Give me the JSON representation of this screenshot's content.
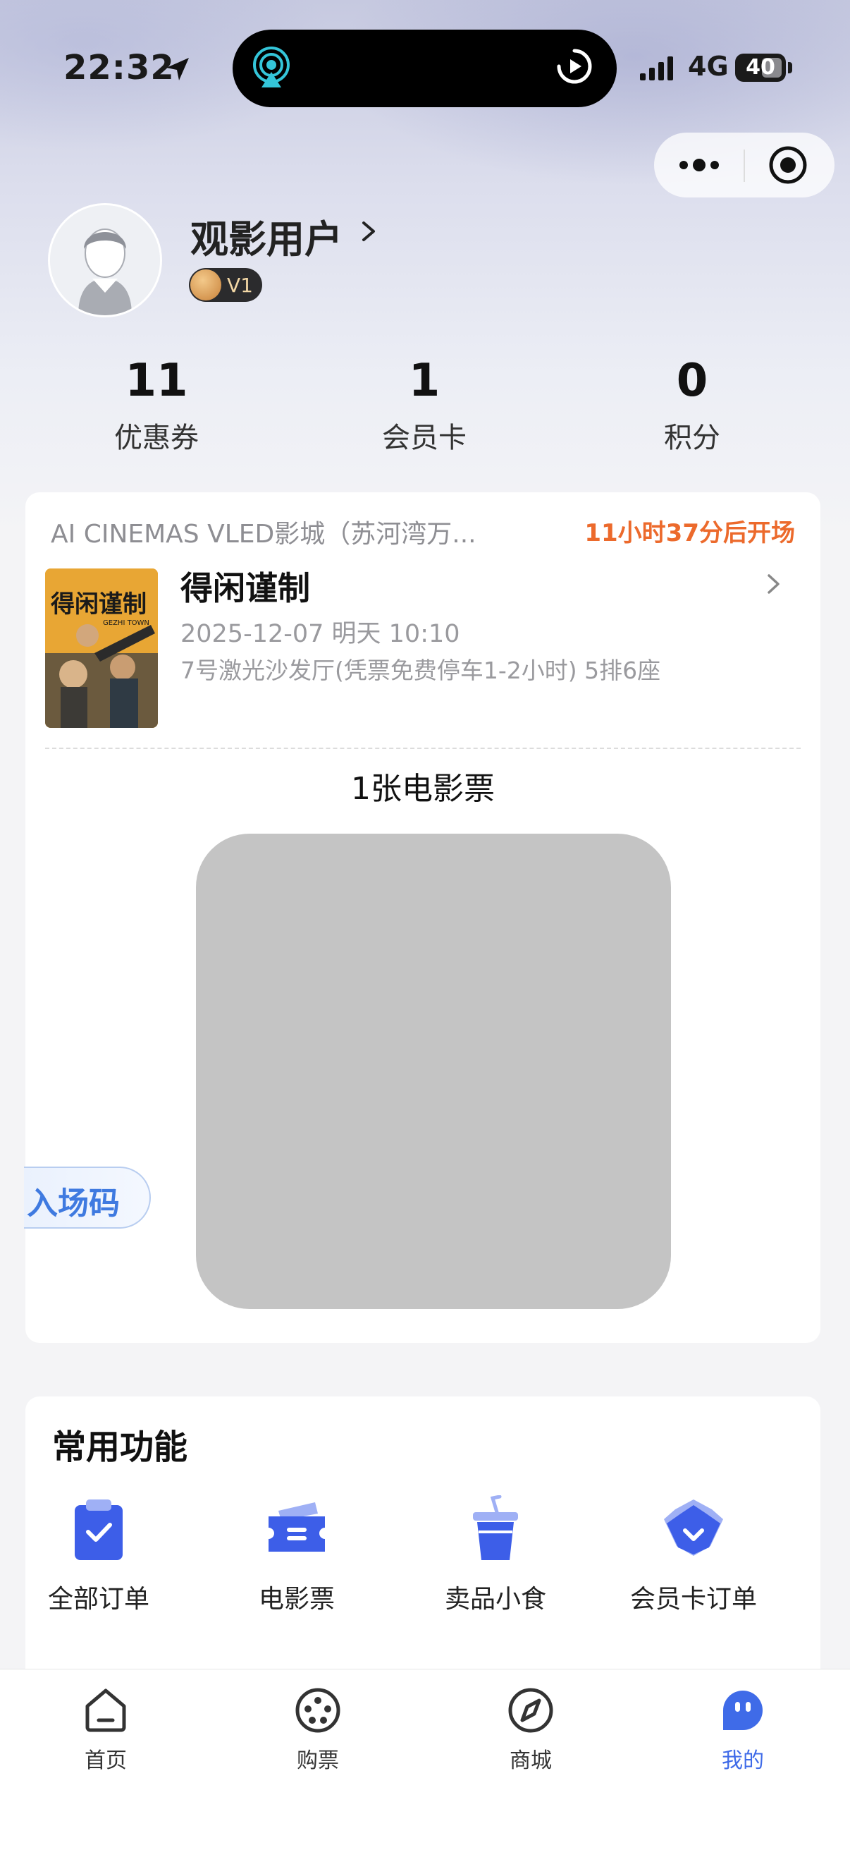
{
  "status_bar": {
    "time": "22:32",
    "network": "4G",
    "battery": "40"
  },
  "profile": {
    "username": "观影用户",
    "level": "V1"
  },
  "stats": [
    {
      "value": "11",
      "label": "优惠券"
    },
    {
      "value": "1",
      "label": "会员卡"
    },
    {
      "value": "0",
      "label": "积分"
    }
  ],
  "ticket": {
    "cinema": "AI CINEMAS VLED影城（苏河湾万...",
    "countdown": "11小时37分后开场",
    "movie_title": "得闲谨制",
    "showtime": "2025-12-07 明天 10:10",
    "hall_seat": "7号激光沙发厅(凭票免费停车1-2小时)  5排6座",
    "ticket_count": "1张电影票",
    "entry_code_label": "入场码",
    "poster_title": "得闲谨制",
    "poster_subtitle": "GEZHI TOWN"
  },
  "functions": {
    "title": "常用功能",
    "items": [
      {
        "label": "全部订单",
        "icon": "clipboard-check-icon"
      },
      {
        "label": "电影票",
        "icon": "ticket-icon"
      },
      {
        "label": "卖品小食",
        "icon": "drink-cup-icon"
      },
      {
        "label": "会员卡订单",
        "icon": "crown-icon"
      }
    ]
  },
  "tab_bar": {
    "items": [
      {
        "label": "首页",
        "icon": "home-icon"
      },
      {
        "label": "购票",
        "icon": "film-reel-icon"
      },
      {
        "label": "商城",
        "icon": "compass-icon"
      },
      {
        "label": "我的",
        "icon": "profile-face-icon",
        "active": true
      }
    ]
  },
  "colors": {
    "accent": "#3f6be8",
    "countdown": "#ec6a2c",
    "entry_code": "#3f7ae0"
  }
}
